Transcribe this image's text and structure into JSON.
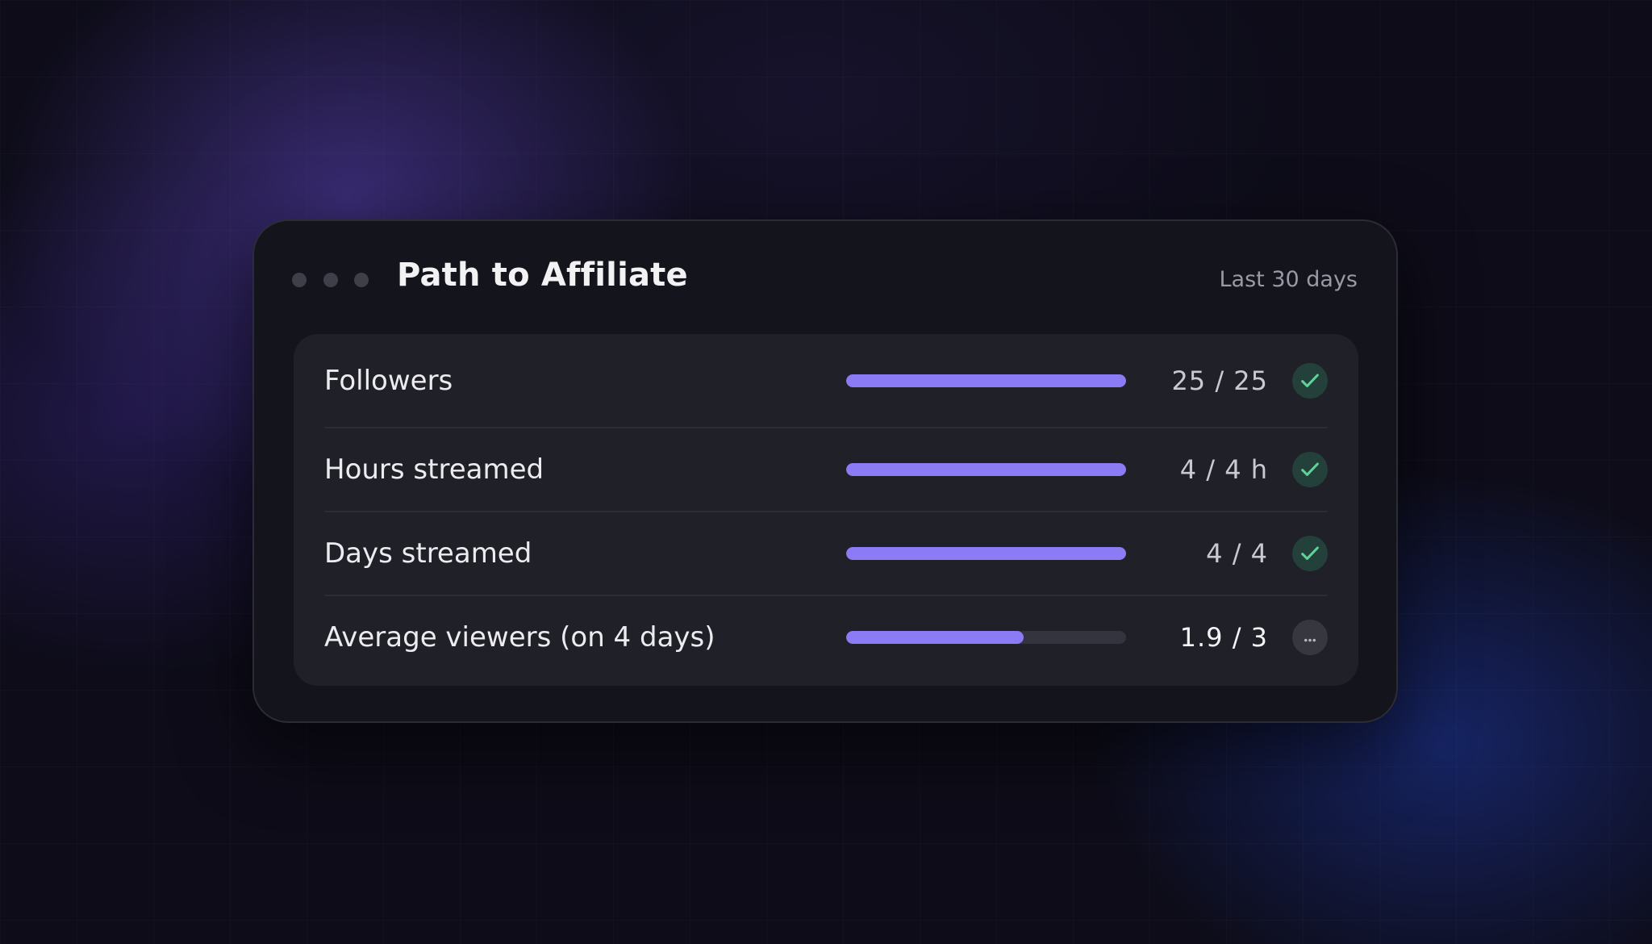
{
  "panel": {
    "title": "Path to Affiliate",
    "range_label": "Last 30 days"
  },
  "rows": [
    {
      "label": "Followers",
      "value": "25 / 25",
      "progress": 1.0,
      "status": "complete",
      "status_icon": "check-icon"
    },
    {
      "label": "Hours streamed",
      "value": "4 / 4 h",
      "progress": 1.0,
      "status": "complete",
      "status_icon": "check-icon"
    },
    {
      "label": "Days streamed",
      "value": "4 / 4",
      "progress": 1.0,
      "status": "complete",
      "status_icon": "check-icon"
    },
    {
      "label": "Average viewers (on 4 days)",
      "value": "1.9 / 3",
      "progress": 0.633,
      "status": "in-progress",
      "status_icon": "ellipsis-icon"
    }
  ],
  "colors": {
    "accent": "#8b7cf6",
    "complete": "#5fd39a",
    "track": "#34343e"
  }
}
